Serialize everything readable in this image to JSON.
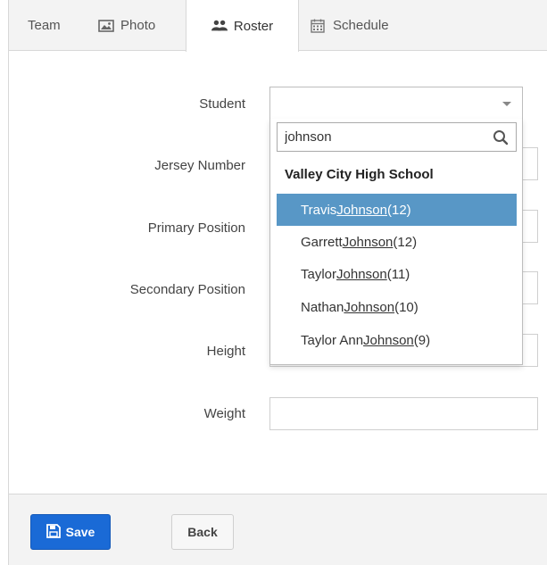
{
  "tabs": [
    {
      "label": "Team",
      "icon": ""
    },
    {
      "label": "Photo",
      "icon": "photo-icon"
    },
    {
      "label": "Roster",
      "icon": "users-icon",
      "active": true
    },
    {
      "label": "Schedule",
      "icon": "calendar-icon"
    }
  ],
  "form": {
    "labels": {
      "student": "Student",
      "jersey": "Jersey Number",
      "primary": "Primary Position",
      "secondary": "Secondary Position",
      "height": "Height",
      "weight": "Weight"
    },
    "student_select": {
      "search_value": "johnson",
      "group": "Valley City High School",
      "options": [
        {
          "first": "Travis ",
          "last": "Johnson",
          "grade": " (12)",
          "highlighted": true
        },
        {
          "first": "Garrett ",
          "last": "Johnson",
          "grade": " (12)"
        },
        {
          "first": "Taylor ",
          "last": "Johnson",
          "grade": " (11)"
        },
        {
          "first": "Nathan ",
          "last": "Johnson",
          "grade": " (10)"
        },
        {
          "first": "Taylor Ann ",
          "last": "Johnson",
          "grade": " (9)"
        }
      ]
    }
  },
  "footer": {
    "save_label": "Save",
    "back_label": "Back"
  },
  "colors": {
    "accent": "#1a6ad6",
    "highlight": "#5897c6"
  }
}
